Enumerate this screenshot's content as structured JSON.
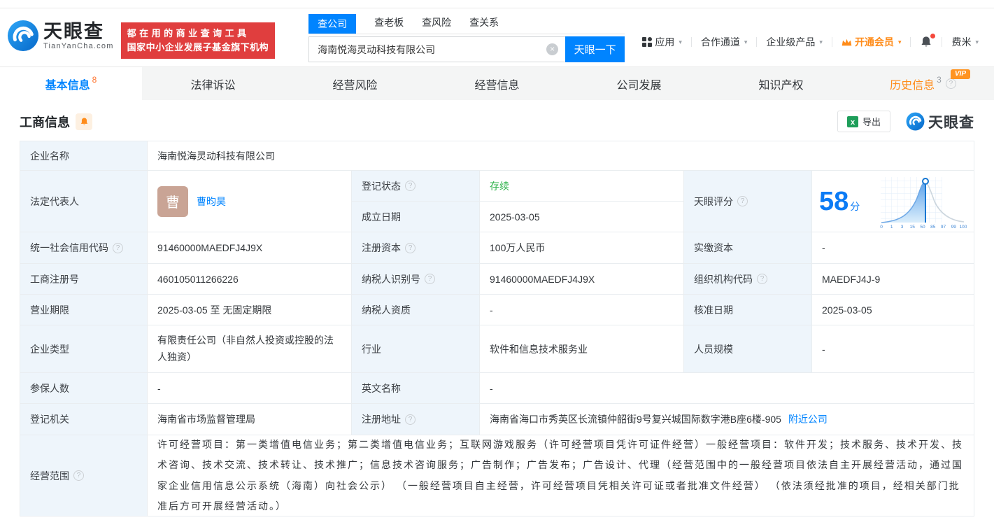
{
  "header": {
    "brand": "天眼查",
    "brand_domain": "TianYanCha.com",
    "slogan_line1": "都在用的商业查询工具",
    "slogan_line2": "国家中小企业发展子基金旗下机构",
    "search_tabs": {
      "company": "查公司",
      "boss": "查老板",
      "risk": "查风险",
      "relation": "查关系"
    },
    "search_value": "海南悦海灵动科技有限公司",
    "search_button": "天眼一下",
    "nav_app": "应用",
    "nav_coop": "合作通道",
    "nav_enterprise": "企业级产品",
    "nav_vip": "开通会员",
    "nav_user": "费米"
  },
  "tabs": {
    "basic": "基本信息",
    "basic_count": "8",
    "legal": "法律诉讼",
    "risk": "经营风险",
    "operation": "经营信息",
    "development": "公司发展",
    "ip": "知识产权",
    "history": "历史信息",
    "history_count": "3",
    "history_vip": "VIP"
  },
  "section": {
    "title": "工商信息",
    "export": "导出",
    "watermark_brand": "天眼查"
  },
  "info": {
    "company_name_label": "企业名称",
    "company_name": "海南悦海灵动科技有限公司",
    "legal_rep_label": "法定代表人",
    "legal_rep_avatar": "曹",
    "legal_rep_name": "曹昀昊",
    "reg_status_label": "登记状态",
    "reg_status": "存续",
    "establish_date_label": "成立日期",
    "establish_date": "2025-03-05",
    "score_label": "天眼评分",
    "score_value": "58",
    "score_unit": "分",
    "credit_code_label": "统一社会信用代码",
    "credit_code": "91460000MAEDFJ4J9X",
    "reg_capital_label": "注册资本",
    "reg_capital": "100万人民币",
    "paid_capital_label": "实缴资本",
    "paid_capital": "-",
    "reg_number_label": "工商注册号",
    "reg_number": "460105011266226",
    "taxpayer_id_label": "纳税人识别号",
    "taxpayer_id": "91460000MAEDFJ4J9X",
    "org_code_label": "组织机构代码",
    "org_code": "MAEDFJ4J-9",
    "business_term_label": "营业期限",
    "business_term": "2025-03-05 至 无固定期限",
    "taxpayer_quality_label": "纳税人资质",
    "taxpayer_quality": "-",
    "approval_date_label": "核准日期",
    "approval_date": "2025-03-05",
    "company_type_label": "企业类型",
    "company_type": "有限责任公司（非自然人投资或控股的法人独资）",
    "industry_label": "行业",
    "industry": "软件和信息技术服务业",
    "staff_size_label": "人员规模",
    "staff_size": "-",
    "insured_label": "参保人数",
    "insured": "-",
    "english_name_label": "英文名称",
    "english_name": "-",
    "reg_authority_label": "登记机关",
    "reg_authority": "海南省市场监督管理局",
    "reg_address_label": "注册地址",
    "reg_address": "海南省海口市秀英区长流镇仲韶街9号复兴城国际数字港B座6楼-905",
    "nearby_link": "附近公司",
    "business_scope_label": "经营范围",
    "business_scope": "许可经营项目：第一类增值电信业务；第二类增值电信业务；互联网游戏服务（许可经营项目凭许可证件经营）一般经营项目：软件开发；技术服务、技术开发、技术咨询、技术交流、技术转让、技术推广；信息技术咨询服务；广告制作；广告发布；广告设计、代理（经营范围中的一般经营项目依法自主开展经营活动，通过国家企业信用信息公示系统（海南）向社会公示） （一般经营项目自主经营，许可经营项目凭相关许可证或者批准文件经营） （依法须经批准的项目，经相关部门批准后方可开展经营活动。）"
  },
  "score_chart": {
    "type": "area",
    "x_labels": [
      "0",
      "1",
      "3",
      "15",
      "50",
      "85",
      "97",
      "99",
      "100"
    ],
    "marker_value": 58,
    "note": "percentile bell curve, filled to score marker"
  },
  "colors": {
    "brand_blue": "#0084ff",
    "badge_red": "#e03e3e",
    "vip_orange": "#ff8c1a",
    "status_green": "#2db24a",
    "label_cell_bg": "#eef5fb"
  }
}
